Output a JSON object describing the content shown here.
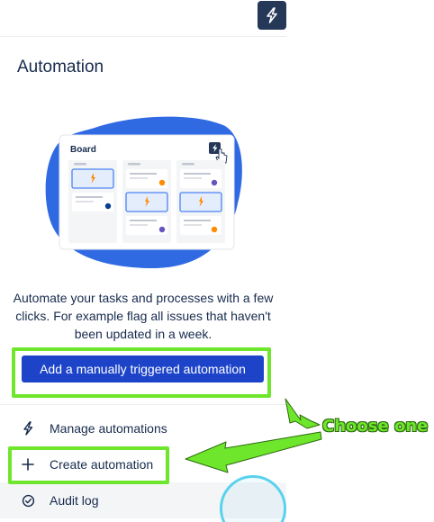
{
  "panel": {
    "title": "Automation",
    "description": "Automate your tasks and processes with a few clicks. For example flag all issues that haven't been updated in a week.",
    "primary_button": "Add a manually triggered automation"
  },
  "illustration": {
    "board_label": "Board"
  },
  "menu": {
    "items": [
      {
        "label": "Manage automations",
        "icon": "bolt-icon"
      },
      {
        "label": "Create automation",
        "icon": "plus-icon"
      },
      {
        "label": "Audit log",
        "icon": "check-circle-icon"
      }
    ]
  },
  "annotation": {
    "callout": "Choose one"
  },
  "colors": {
    "primary": "#1d44c8",
    "highlight": "#6ee62b",
    "blob": "#2f6ae3",
    "dark_button": "#253858"
  }
}
